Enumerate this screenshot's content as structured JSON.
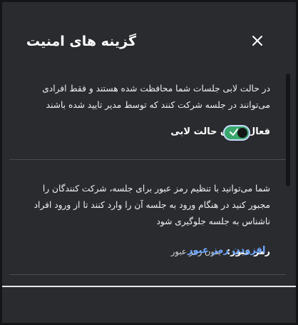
{
  "dialog": {
    "title": "گزینه های امنیت"
  },
  "lobby": {
    "description_line1": "در حالت لابی جلسات شما محافظت شده هستند و فقط افرادی",
    "description_line2": "می‌توانند در جلسه شرکت کنند که توسط مدیر تایید شده باشند",
    "toggle_label": "فعال کردن حالت لابی",
    "enabled": true
  },
  "password": {
    "description_line1": "شما می‌توانید با تنظیم رمز عبور برای جلسه، شرکت کنندگان را",
    "description_line2": "مجبور کنید در هنگام ورود به جلسه آن را وارد کنند تا از ورود افراد",
    "description_line3": "ناشناس به جلسه جلوگیری شود",
    "label": "رمز عبور:",
    "value": "بدون رمز عبور",
    "add_button": "افزودن رمز عبور"
  },
  "colors": {
    "background": "#2a2b2f",
    "accent_link": "#6fa8ff",
    "toggle_on": "#3aa76d"
  }
}
